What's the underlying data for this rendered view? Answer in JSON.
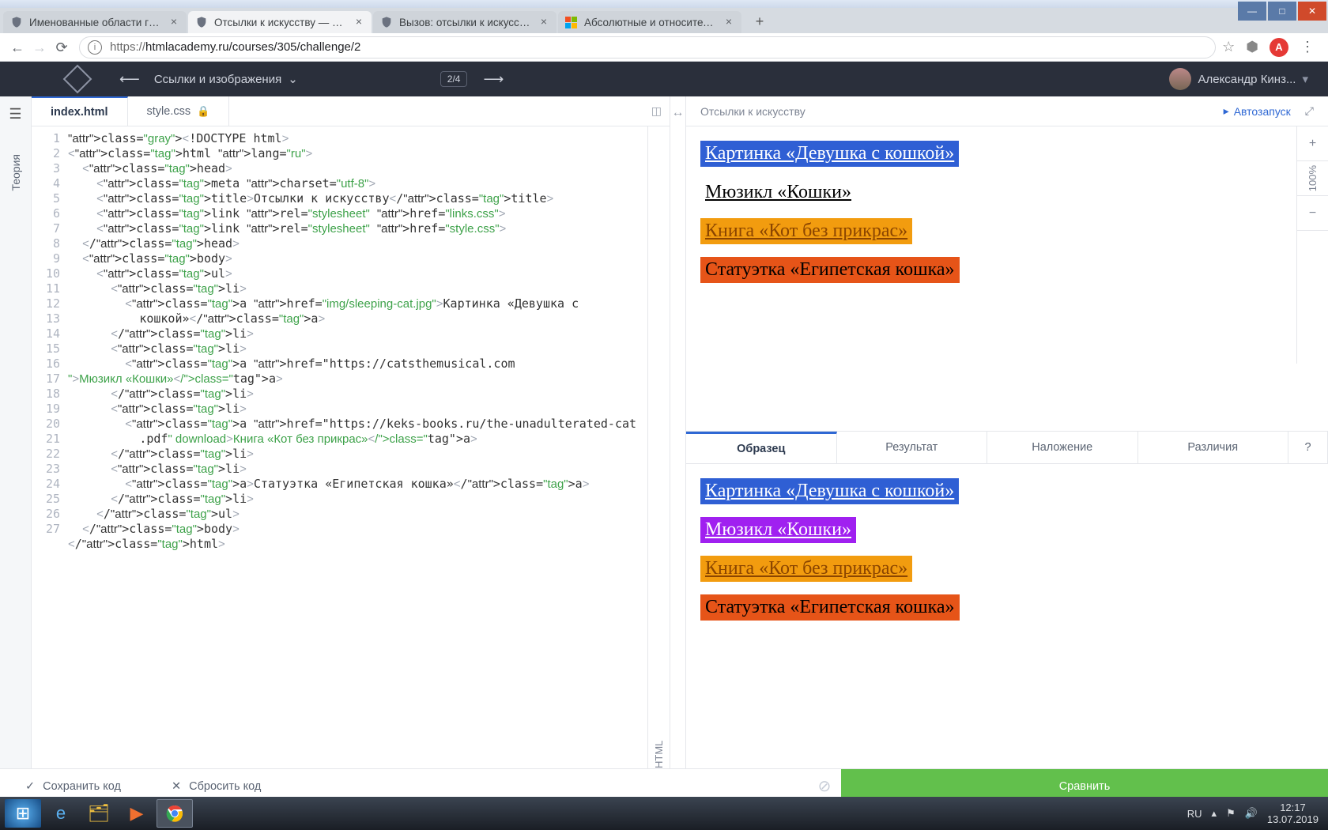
{
  "browser": {
    "tabs": [
      {
        "title": "Именованные области грида: с",
        "favicon": "shield"
      },
      {
        "title": "Отсылки к искусству — Ссылки",
        "favicon": "shield",
        "active": true
      },
      {
        "title": "Вызов: отсылки к искусству - Ку",
        "favicon": "shield"
      },
      {
        "title": "Абсолютные и относительные",
        "favicon": "squares"
      }
    ],
    "url_host": "https://",
    "url_path": "htmlacademy.ru/courses/305/challenge/2"
  },
  "app_header": {
    "course": "Ссылки и изображения",
    "counter": "2/4",
    "user": "Александр Кинз..."
  },
  "theory_label": "Теория",
  "file_tabs": {
    "index": "index.html",
    "style": "style.css"
  },
  "html_rail": "HTML",
  "gutter": " 1\n 2\n 3\n 4\n 5\n 6\n 7\n 8\n 9\n10\n11\n12\n13\n14\n15\n16\n17\n18\n19\n20\n21\n22\n23\n24\n25\n26\n27",
  "code_lines": [
    "<!DOCTYPE html>",
    "<html lang=\"ru\">",
    "  <head>",
    "    <meta charset=\"utf-8\">",
    "    <title>Отсылки к искусству</title>",
    "    <link rel=\"stylesheet\" href=\"links.css\">",
    "    <link rel=\"stylesheet\" href=\"style.css\">",
    "  </head>",
    "  <body>",
    "    <ul>",
    "      <li>",
    "        <a href=\"img/sleeping-cat.jpg\">Картинка «Девушка с",
    "          кошкой»</a>",
    "      </li>",
    "      <li>",
    "        <a href=\"https://catsthemusical.com",
    "\">Мюзикл «Кошки»</a>",
    "      </li>",
    "      <li>",
    "        <a href=\"https://keks-books.ru/the-unadulterated-cat",
    "          .pdf\" download>Книга «Кот без прикрас»</a>",
    "      </li>",
    "      <li>",
    "        <a>Статуэтка «Египетская кошка»</a>",
    "      </li>",
    "    </ul>",
    "  </body>",
    "</html>"
  ],
  "preview": {
    "title": "Отсылки к искусству",
    "autorun": "Автозапуск",
    "links": [
      {
        "text": "Картинка «Девушка с кошкой»",
        "cls": "blue-bg"
      },
      {
        "text": "Мюзикл «Кошки»",
        "cls": "plain-u"
      },
      {
        "text": "Книга «Кот без прикрас»",
        "cls": "orange-bg"
      },
      {
        "text": "Статуэтка «Египетская кошка»",
        "cls": "darkorange-bg"
      }
    ],
    "tabs": {
      "sample": "Образец",
      "result": "Результат",
      "overlay": "Наложение",
      "diff": "Различия",
      "q": "?"
    },
    "reference_links": [
      {
        "text": "Картинка «Девушка с кошкой»",
        "cls": "blue-bg"
      },
      {
        "text": "Мюзикл «Кошки»",
        "cls": "purple-bg"
      },
      {
        "text": "Книга «Кот без прикрас»",
        "cls": "orange-bg"
      },
      {
        "text": "Статуэтка «Египетская кошка»",
        "cls": "darkorange-bg"
      }
    ],
    "rail_100": "100%"
  },
  "footer": {
    "save": "Сохранить код",
    "reset": "Сбросить код",
    "compare": "Сравнить"
  },
  "taskbar": {
    "lang": "RU",
    "time": "12:17",
    "date": "13.07.2019"
  }
}
